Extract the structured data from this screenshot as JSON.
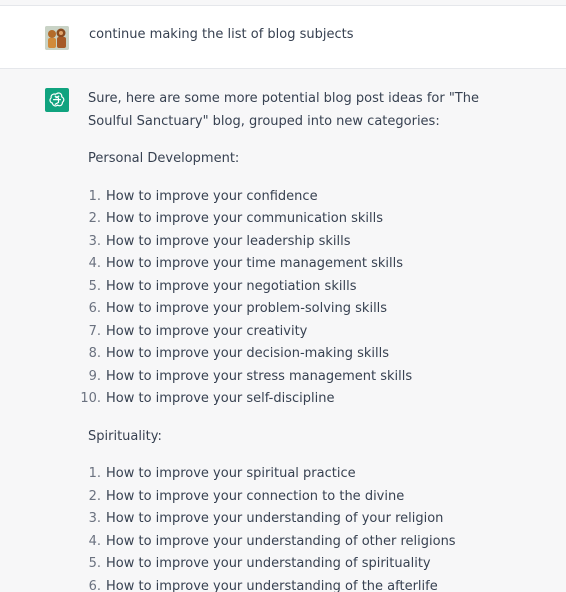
{
  "user_message": {
    "text": "continue making the list of blog subjects"
  },
  "assistant_message": {
    "intro": "Sure, here are some more potential blog post ideas for \"The Soulful Sanctuary\" blog, grouped into new categories:",
    "sections": [
      {
        "heading": "Personal Development:",
        "items": [
          "How to improve your confidence",
          "How to improve your communication skills",
          "How to improve your leadership skills",
          "How to improve your time management skills",
          "How to improve your negotiation skills",
          "How to improve your problem-solving skills",
          "How to improve your creativity",
          "How to improve your decision-making skills",
          "How to improve your stress management skills",
          "How to improve your self-discipline"
        ]
      },
      {
        "heading": "Spirituality:",
        "items": [
          "How to improve your spiritual practice",
          "How to improve your connection to the divine",
          "How to improve your understanding of your religion",
          "How to improve your understanding of other religions",
          "How to improve your understanding of spirituality",
          "How to improve your understanding of the afterlife"
        ]
      }
    ]
  },
  "colors": {
    "assistant_avatar_bg": "#10a37f",
    "user_row_bg": "#ffffff",
    "assistant_row_bg": "#f7f7f8",
    "text": "#374151"
  },
  "icons": {
    "user_avatar": "user-avatar-icon",
    "assistant_avatar": "openai-logo-icon"
  }
}
